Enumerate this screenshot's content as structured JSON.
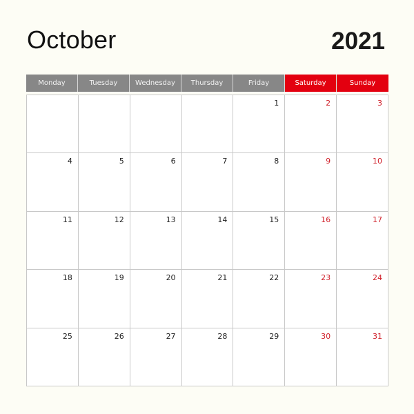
{
  "header": {
    "month": "October",
    "year": "2021"
  },
  "colors": {
    "weekday_header": "#878787",
    "weekend_header": "#e3000f",
    "weekend_text": "#d0202a",
    "background": "#fdfdf5"
  },
  "days": [
    {
      "label": "Monday",
      "weekend": false
    },
    {
      "label": "Tuesday",
      "weekend": false
    },
    {
      "label": "Wednesday",
      "weekend": false
    },
    {
      "label": "Thursday",
      "weekend": false
    },
    {
      "label": "Friday",
      "weekend": false
    },
    {
      "label": "Saturday",
      "weekend": true
    },
    {
      "label": "Sunday",
      "weekend": true
    }
  ],
  "weeks": [
    [
      "",
      "",
      "",
      "",
      "1",
      "2",
      "3"
    ],
    [
      "4",
      "5",
      "6",
      "7",
      "8",
      "9",
      "10"
    ],
    [
      "11",
      "12",
      "13",
      "14",
      "15",
      "16",
      "17"
    ],
    [
      "18",
      "19",
      "20",
      "21",
      "22",
      "23",
      "24"
    ],
    [
      "25",
      "26",
      "27",
      "28",
      "29",
      "30",
      "31"
    ]
  ]
}
